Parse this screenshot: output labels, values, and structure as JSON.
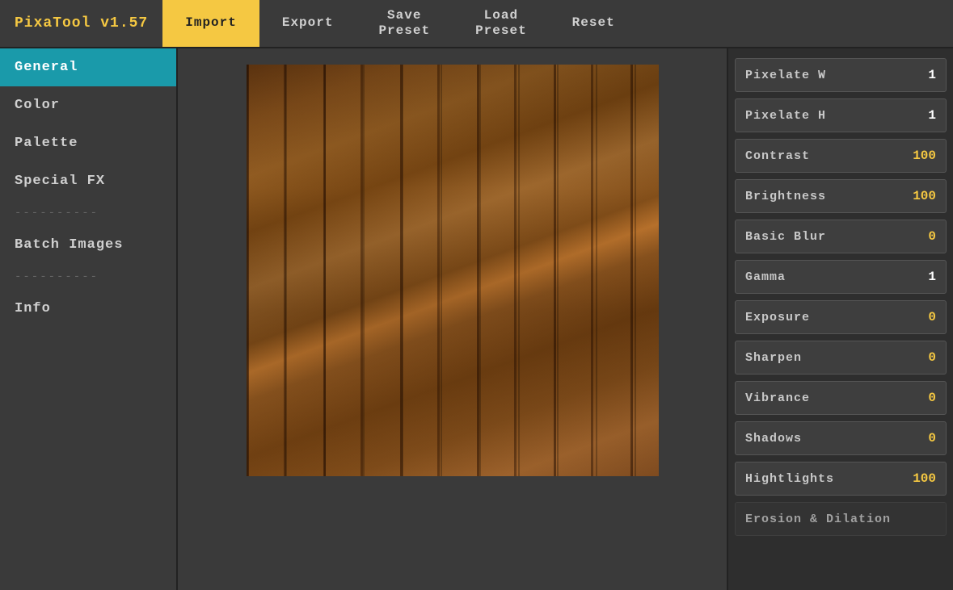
{
  "app": {
    "title": "PixaTool v1.57"
  },
  "topbar": {
    "brand": "PixaTool v1.57",
    "buttons": [
      {
        "id": "import",
        "label": "Import",
        "active": true
      },
      {
        "id": "export",
        "label": "Export",
        "active": false
      },
      {
        "id": "save-preset",
        "label": "Save\nPreset",
        "active": false
      },
      {
        "id": "load-preset",
        "label": "Load\nPreset",
        "active": false
      },
      {
        "id": "reset",
        "label": "Reset",
        "active": false
      }
    ]
  },
  "sidebar": {
    "items": [
      {
        "id": "general",
        "label": "General",
        "active": true
      },
      {
        "id": "color",
        "label": "Color",
        "active": false
      },
      {
        "id": "palette",
        "label": "Palette",
        "active": false
      },
      {
        "id": "special-fx",
        "label": "Special FX",
        "active": false
      },
      {
        "id": "divider1",
        "label": "----------",
        "divider": true
      },
      {
        "id": "batch-images",
        "label": "Batch Images",
        "active": false
      },
      {
        "id": "divider2",
        "label": "----------",
        "divider": true
      },
      {
        "id": "info",
        "label": "Info",
        "active": false
      }
    ]
  },
  "controls": {
    "rows": [
      {
        "id": "pixelate-w",
        "label": "Pixelate W",
        "value": "1",
        "valueColor": "white"
      },
      {
        "id": "pixelate-h",
        "label": "Pixelate H",
        "value": "1",
        "valueColor": "white"
      },
      {
        "id": "contrast",
        "label": "Contrast",
        "value": "100",
        "valueColor": "yellow"
      },
      {
        "id": "brightness",
        "label": "Brightness",
        "value": "100",
        "valueColor": "yellow"
      },
      {
        "id": "basic-blur",
        "label": "Basic Blur",
        "value": "0",
        "valueColor": "yellow"
      },
      {
        "id": "gamma",
        "label": "Gamma",
        "value": "1",
        "valueColor": "white"
      },
      {
        "id": "exposure",
        "label": "Exposure",
        "value": "0",
        "valueColor": "yellow"
      },
      {
        "id": "sharpen",
        "label": "Sharpen",
        "value": "0",
        "valueColor": "yellow"
      },
      {
        "id": "vibrance",
        "label": "Vibrance",
        "value": "0",
        "valueColor": "yellow"
      },
      {
        "id": "shadows",
        "label": "Shadows",
        "value": "0",
        "valueColor": "yellow"
      },
      {
        "id": "highlights",
        "label": "Hightlights",
        "value": "100",
        "valueColor": "yellow"
      },
      {
        "id": "erosion-dilation",
        "label": "Erosion & Dilation",
        "value": "",
        "valueColor": "yellow",
        "dimmed": true
      }
    ]
  }
}
